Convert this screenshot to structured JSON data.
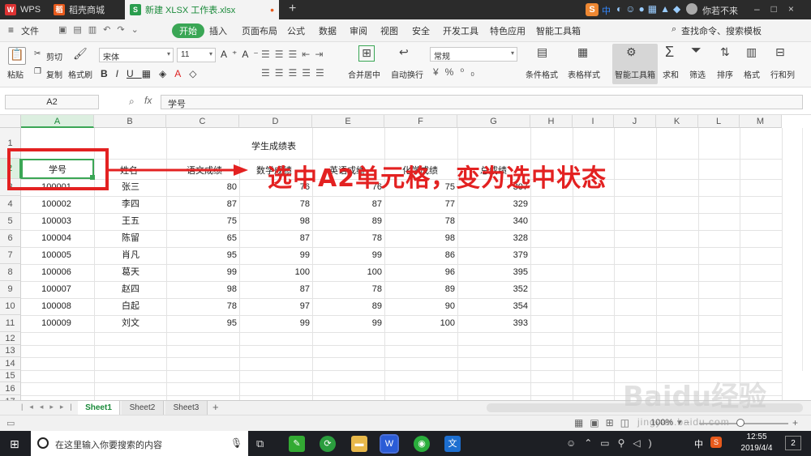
{
  "window": {
    "tabs": [
      {
        "label": "WPS",
        "glyph": "W"
      },
      {
        "label": "稻壳商城",
        "glyph": "稻"
      },
      {
        "label": "新建 XLSX 工作表.xlsx",
        "glyph": "S"
      }
    ],
    "new_tab": "+",
    "user_name": "你若不来",
    "ime_label": "中"
  },
  "menu": {
    "file": "文件",
    "items": [
      "开始",
      "插入",
      "页面布局",
      "公式",
      "数据",
      "审阅",
      "视图",
      "安全",
      "开发工具",
      "特色应用",
      "智能工具箱"
    ],
    "search": "查找命令、搜索模板"
  },
  "ribbon": {
    "paste": "粘贴",
    "cut": "剪切",
    "copy": "复制",
    "format_painter": "格式刷",
    "font_name": "宋体",
    "font_size": "11",
    "merge_center": "合并居中",
    "wrap_text": "自动换行",
    "number_format": "常规",
    "conditional_format": "条件格式",
    "table_style": "表格样式",
    "smart_toolbox": "智能工具箱",
    "sum": "求和",
    "filter": "筛选",
    "sort": "排序",
    "format": "格式",
    "row_col": "行和列"
  },
  "formula_bar": {
    "name_box": "A2",
    "fx": "fx",
    "value": "学号"
  },
  "sheet": {
    "columns": [
      "A",
      "B",
      "C",
      "D",
      "E",
      "F",
      "G",
      "H",
      "I",
      "J",
      "K",
      "L",
      "M"
    ],
    "rows": [
      "1",
      "2",
      "3",
      "4",
      "5",
      "6",
      "7",
      "8",
      "9",
      "10",
      "11",
      "12",
      "13",
      "14",
      "15",
      "16",
      "17"
    ],
    "title": "学生成绩表",
    "headers": [
      "学号",
      "姓名",
      "语文成绩",
      "数学成绩",
      "英语成绩",
      "化学成绩",
      "总成绩"
    ],
    "data": [
      [
        "100001",
        "张三",
        "80",
        "76",
        "76",
        "75",
        "307"
      ],
      [
        "100002",
        "李四",
        "87",
        "78",
        "87",
        "77",
        "329"
      ],
      [
        "100003",
        "王五",
        "75",
        "98",
        "89",
        "78",
        "340"
      ],
      [
        "100004",
        "陈留",
        "65",
        "87",
        "78",
        "98",
        "328"
      ],
      [
        "100005",
        "肖凡",
        "95",
        "99",
        "99",
        "86",
        "379"
      ],
      [
        "100006",
        "葛天",
        "99",
        "100",
        "100",
        "96",
        "395"
      ],
      [
        "100007",
        "赵四",
        "98",
        "87",
        "78",
        "89",
        "352"
      ],
      [
        "100008",
        "白起",
        "78",
        "97",
        "89",
        "90",
        "354"
      ],
      [
        "100009",
        "刘文",
        "95",
        "99",
        "99",
        "100",
        "393"
      ]
    ]
  },
  "sheet_tabs": [
    "Sheet1",
    "Sheet2",
    "Sheet3"
  ],
  "status": {
    "zoom": "100%"
  },
  "annotation": "选中A2单元格，变为选中状态",
  "taskbar": {
    "search_placeholder": "在这里输入你要搜索的内容",
    "time": "12:55",
    "date": "2019/4/4",
    "ime": "中",
    "notifications": "2"
  },
  "watermark": {
    "brand": "Baidu经验",
    "url": "jingyan.baidu.com"
  },
  "colors": {
    "accent": "#3aa655",
    "selection": "#1a8a3a",
    "annotation": "#e32121"
  }
}
